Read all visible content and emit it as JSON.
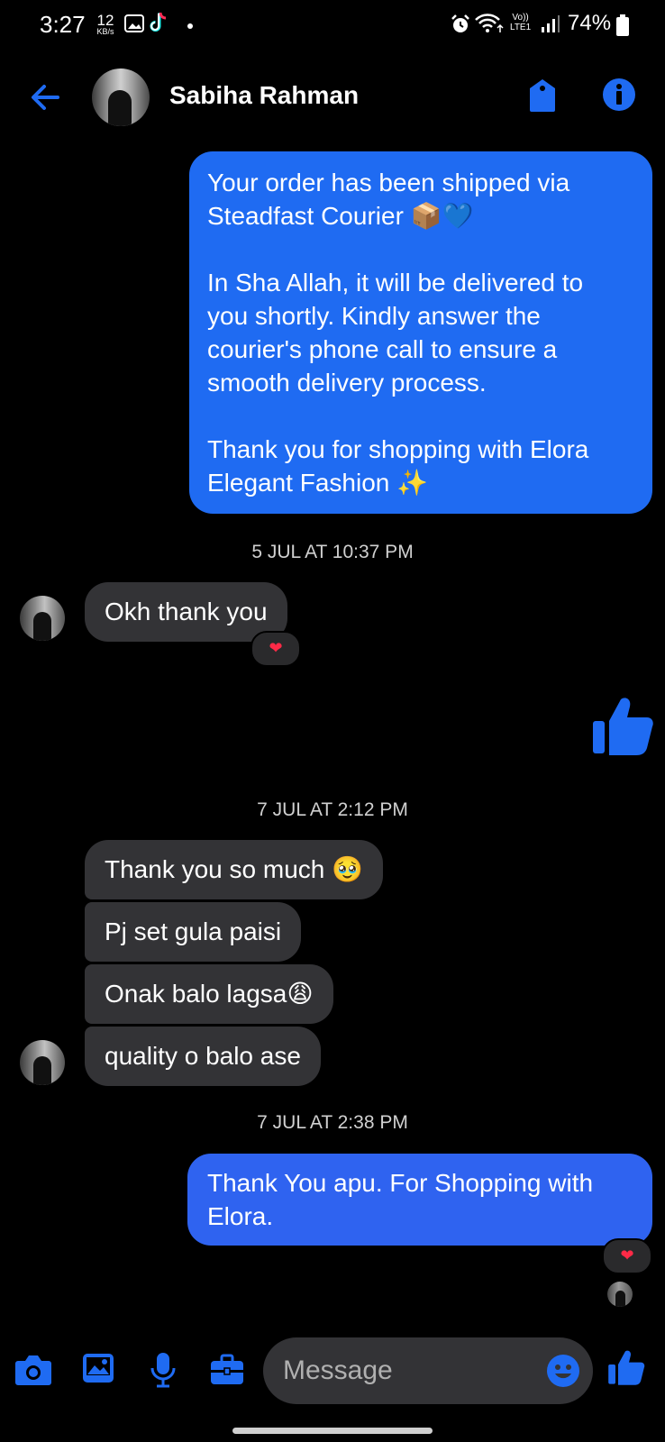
{
  "status_bar": {
    "time": "3:27",
    "net_speed_value": "12",
    "net_speed_unit": "KB/s",
    "volte_line1": "Vo))",
    "volte_line2": "LTE1",
    "battery": "74%"
  },
  "header": {
    "contact_name": "Sabiha Rahman",
    "accent_color": "#1f6bf2"
  },
  "messages": [
    {
      "kind": "outgoing",
      "lines": [
        "Your order has been shipped via",
        "Steadfast Courier 📦💙",
        "",
        "In Sha Allah, it will be delivered to",
        "you shortly. Kindly answer the",
        "courier's phone call to ensure a",
        "smooth delivery process.",
        "",
        "Thank you for shopping with Elora",
        "Elegant Fashion ✨"
      ]
    },
    {
      "kind": "timestamp",
      "text": "5 JUL AT 10:37 PM"
    },
    {
      "kind": "incoming",
      "text": "Okh thank you",
      "reaction": "❤"
    },
    {
      "kind": "outgoing-like"
    },
    {
      "kind": "timestamp",
      "text": "7 JUL AT 2:12 PM"
    },
    {
      "kind": "incoming",
      "text": "Thank you so much 🥹"
    },
    {
      "kind": "incoming",
      "text": "Pj set gula paisi"
    },
    {
      "kind": "incoming",
      "text": "Onak balo lagsa😩"
    },
    {
      "kind": "incoming",
      "text": "quality o balo ase"
    },
    {
      "kind": "timestamp",
      "text": "7 JUL AT 2:38 PM"
    },
    {
      "kind": "outgoing",
      "lines": [
        "Thank You apu. For Shopping with",
        "Elora."
      ],
      "reaction": "❤"
    }
  ],
  "composer": {
    "placeholder": "Message"
  }
}
